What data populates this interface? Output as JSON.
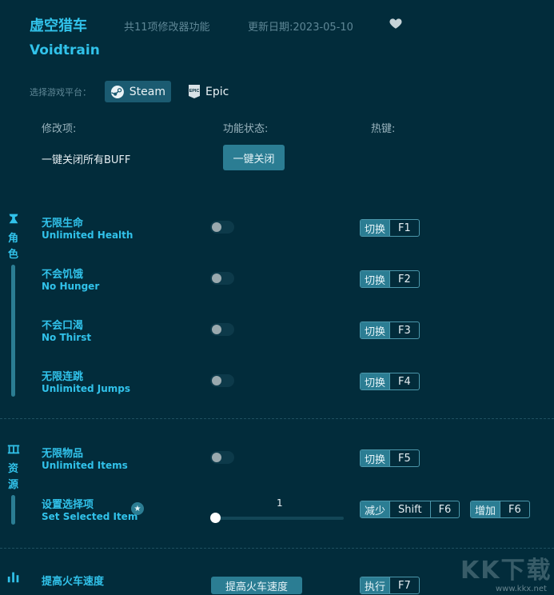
{
  "header": {
    "title_cn": "虚空猎车",
    "title_en": "Voidtrain",
    "feature_count": "共11项修改器功能",
    "update_date": "更新日期:2023-05-10",
    "favorite_icon": "heart-icon"
  },
  "platform": {
    "label": "选择游戏平台：",
    "options": [
      {
        "label": "Steam",
        "icon": "steam-icon",
        "selected": true
      },
      {
        "label": "Epic",
        "icon": "epic-games-icon",
        "selected": false
      }
    ]
  },
  "columns": {
    "mod": "修改项:",
    "status": "功能状态:",
    "hotkey": "热键:"
  },
  "one_click": {
    "label": "一键关闭所有BUFF",
    "button": "一键关闭"
  },
  "categories": [
    {
      "label": "角色",
      "icon": "character-icon"
    },
    {
      "label": "资源",
      "icon": "resource-icon"
    },
    {
      "label": "",
      "icon": "bar-chart-icon"
    }
  ],
  "items": [
    {
      "cn": "无限生命",
      "en": "Unlimited Health",
      "enabled": false,
      "hotkey": {
        "action": "切换",
        "key": "F1"
      }
    },
    {
      "cn": "不会饥饿",
      "en": "No Hunger",
      "enabled": false,
      "hotkey": {
        "action": "切换",
        "key": "F2"
      }
    },
    {
      "cn": "不会口渴",
      "en": "No Thirst",
      "enabled": false,
      "hotkey": {
        "action": "切换",
        "key": "F3"
      }
    },
    {
      "cn": "无限连跳",
      "en": "Unlimited Jumps",
      "enabled": false,
      "hotkey": {
        "action": "切换",
        "key": "F4"
      }
    },
    {
      "cn": "无限物品",
      "en": "Unlimited Items",
      "enabled": false,
      "hotkey": {
        "action": "切换",
        "key": "F5"
      }
    }
  ],
  "set_item": {
    "cn": "设置选择项",
    "en": "Set Selected Item",
    "value": "1",
    "slider_fraction": 0,
    "decrease": {
      "action": "减少",
      "mod": "Shift",
      "key": "F6"
    },
    "increase": {
      "action": "增加",
      "key": "F6"
    }
  },
  "speed": {
    "cn": "提高火车速度",
    "button": "提高火车速度",
    "hotkey": {
      "action": "执行",
      "key": "F7"
    }
  },
  "watermark": {
    "text": "KK下载",
    "url": "www.kkx.net"
  },
  "colors": {
    "background": "#022c3b",
    "accent": "#31c2ea",
    "button": "#2b7d93"
  }
}
